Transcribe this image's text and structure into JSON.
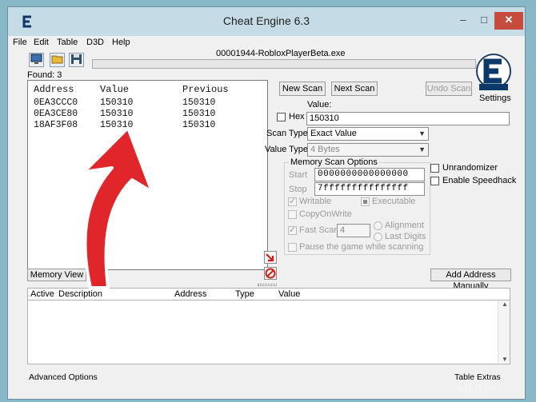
{
  "window": {
    "title": "Cheat Engine 6.3",
    "min_glyph": "–",
    "max_glyph": "□",
    "close_glyph": "✕"
  },
  "menu": [
    "File",
    "Edit",
    "Table",
    "D3D",
    "Help"
  ],
  "process_name": "00001944-RobloxPlayerBeta.exe",
  "found_label": "Found: 3",
  "settings_label": "Settings",
  "results": {
    "columns": [
      "Address",
      "Value",
      "Previous"
    ],
    "rows": [
      {
        "address": "0EA3CCC0",
        "value": "150310",
        "previous": "150310"
      },
      {
        "address": "0EA3CE80",
        "value": "150310",
        "previous": "150310"
      },
      {
        "address": "18AF3F08",
        "value": "150310",
        "previous": "150310"
      }
    ]
  },
  "buttons": {
    "new_scan": "New Scan",
    "next_scan": "Next Scan",
    "undo_scan": "Undo Scan",
    "memory_view": "Memory View",
    "add_address": "Add Address Manually"
  },
  "scan": {
    "value_label": "Value:",
    "hex_label": "Hex",
    "value": "150310",
    "scan_type_label": "Scan Type",
    "scan_type": "Exact Value",
    "value_type_label": "Value Type",
    "value_type": "4 Bytes"
  },
  "memory_options": {
    "title": "Memory Scan Options",
    "start_label": "Start",
    "start_value": "0000000000000000",
    "stop_label": "Stop",
    "stop_value": "7fffffffffffffff",
    "writable": "Writable",
    "executable": "Executable",
    "copy_on_write": "CopyOnWrite",
    "fast_scan": "Fast Scan",
    "fast_scan_value": "4",
    "alignment": "Alignment",
    "last_digits": "Last Digits",
    "pause": "Pause the game while scanning"
  },
  "right_options": {
    "unrandomizer": "Unrandomizer",
    "speedhack": "Enable Speedhack"
  },
  "address_table": {
    "columns": [
      "Active",
      "Description",
      "Address",
      "Type",
      "Value"
    ]
  },
  "status": {
    "left": "Advanced Options",
    "right": "Table Extras"
  },
  "watermark": "wikiHow",
  "colors": {
    "arrow_red": "#e0262b",
    "titlebar": "#c5dbe6",
    "background": "#88b7c8"
  }
}
